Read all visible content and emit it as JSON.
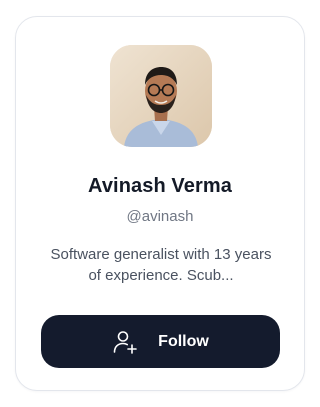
{
  "profile": {
    "name": "Avinash Verma",
    "handle": "@avinash",
    "bio": "Software generalist with 13 years of experience. Scub..."
  },
  "actions": {
    "follow_label": "Follow",
    "follow_icon": "user-plus-icon"
  },
  "colors": {
    "button_bg": "#141b2d",
    "name_text": "#141a27",
    "muted_text": "#707784",
    "card_border": "#e3e6ec"
  }
}
